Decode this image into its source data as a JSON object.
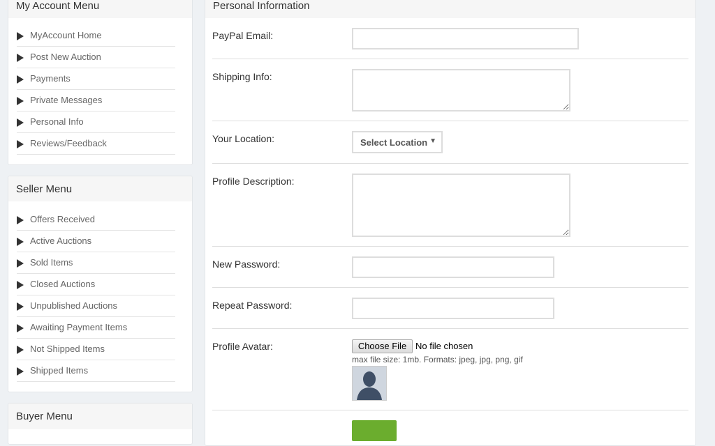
{
  "account_menu": {
    "title": "My Account Menu",
    "items": [
      "MyAccount Home",
      "Post New Auction",
      "Payments",
      "Private Messages",
      "Personal Info",
      "Reviews/Feedback"
    ]
  },
  "seller_menu": {
    "title": "Seller Menu",
    "items": [
      "Offers Received",
      "Active Auctions",
      "Sold Items",
      "Closed Auctions",
      "Unpublished Auctions",
      "Awaiting Payment Items",
      "Not Shipped Items",
      "Shipped Items"
    ]
  },
  "buyer_menu": {
    "title": "Buyer Menu"
  },
  "form": {
    "title": "Personal Information",
    "labels": {
      "paypal": "PayPal Email:",
      "shipping": "Shipping Info:",
      "location": "Your Location:",
      "description": "Profile Description:",
      "new_password": "New Password:",
      "repeat_password": "Repeat Password:",
      "avatar": "Profile Avatar:"
    },
    "values": {
      "paypal": "",
      "shipping": "",
      "description": "",
      "new_password": "",
      "repeat_password": ""
    },
    "location_select": "Select Location",
    "file_button": "Choose File",
    "file_status": "No file chosen",
    "file_hint": "max file size: 1mb. Formats: jpeg, jpg, png, gif"
  },
  "colors": {
    "submit_green": "#6bad2e",
    "page_bg": "#eef1f4",
    "header_bg": "#f6f6f6"
  },
  "icons": {
    "menu_arrow": "triangle-right-icon",
    "select_arrow": "caret-down-icon",
    "avatar": "default-avatar-icon"
  }
}
